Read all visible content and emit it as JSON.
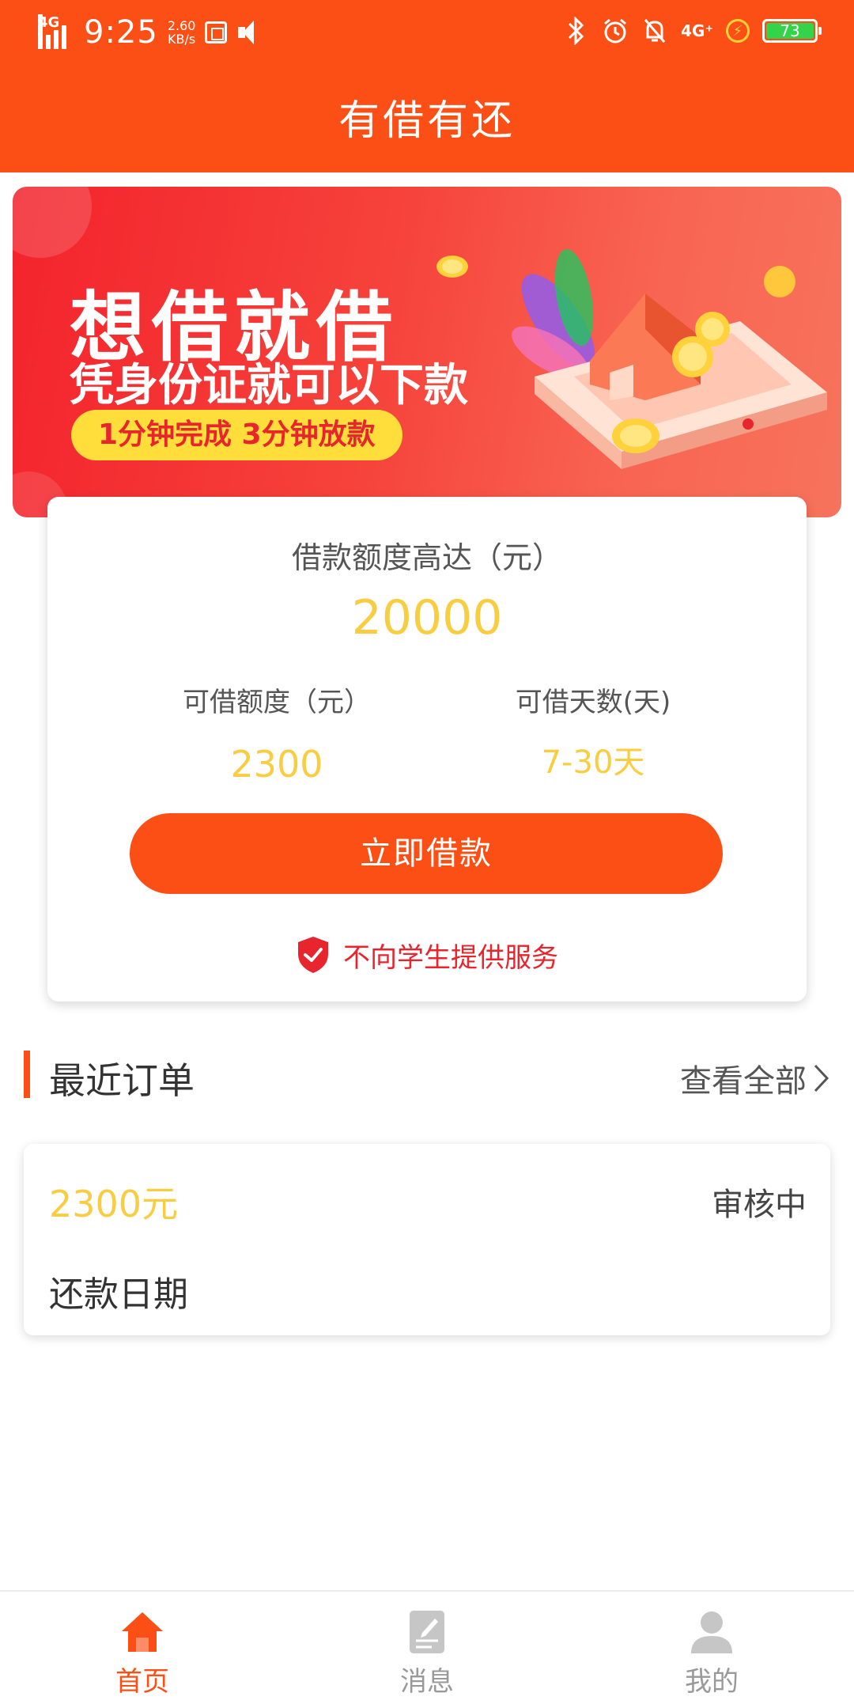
{
  "status_bar": {
    "network_left": "4G",
    "time": "9:25",
    "speed_value": "2.60",
    "speed_unit": "KB/s",
    "network_right": "4G⁺",
    "battery": "73"
  },
  "header": {
    "title": "有借有还"
  },
  "banner": {
    "headline": "想借就借",
    "subline": "凭身份证就可以下款",
    "pill": "1分钟完成 3分钟放款"
  },
  "loan_card": {
    "max_label": "借款额度高达（元）",
    "max_value": "20000",
    "available_label": "可借额度（元）",
    "available_value": "2300",
    "days_label": "可借天数(天)",
    "days_value": "7-30天",
    "button": "立即借款",
    "notice": "不向学生提供服务"
  },
  "orders": {
    "title": "最近订单",
    "view_all": "查看全部",
    "items": [
      {
        "amount": "2300元",
        "status": "审核中",
        "date_label": "还款日期"
      }
    ]
  },
  "bottom_nav": {
    "items": [
      {
        "label": "首页"
      },
      {
        "label": "消息"
      },
      {
        "label": "我的"
      }
    ]
  },
  "colors": {
    "primary": "#fc4f16",
    "amount": "#f9cd42",
    "alert": "#e8242c"
  }
}
